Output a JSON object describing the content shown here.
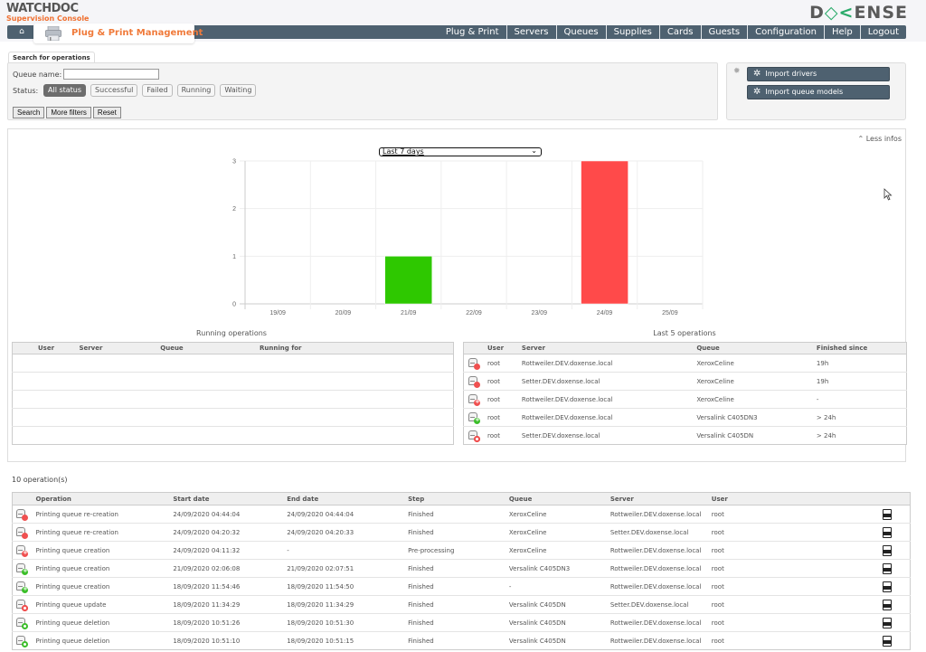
{
  "header": {
    "logo_brand": "WATCHDOC",
    "logo_subtitle": "Supervision Console",
    "vendor_logo_left": "D",
    "vendor_logo_mark": "◇<",
    "vendor_logo_right": "ENSE",
    "section_title": "Plug & Print Management",
    "home_icon": "home-icon",
    "nav": [
      {
        "label": "Plug & Print"
      },
      {
        "label": "Servers"
      },
      {
        "label": "Queues"
      },
      {
        "label": "Supplies"
      },
      {
        "label": "Cards"
      },
      {
        "label": "Guests"
      },
      {
        "label": "Configuration"
      },
      {
        "label": "Help"
      },
      {
        "label": "Logout"
      }
    ]
  },
  "search": {
    "tab_label": "Search for operations",
    "queue_name_label": "Queue name:",
    "queue_name_value": "",
    "status_label": "Status:",
    "statuses": [
      {
        "label": "All status",
        "active": true
      },
      {
        "label": "Successful",
        "active": false
      },
      {
        "label": "Failed",
        "active": false
      },
      {
        "label": "Running",
        "active": false
      },
      {
        "label": "Waiting",
        "active": false
      }
    ],
    "search_button": "Search",
    "more_filters_button": "More filters",
    "reset_button": "Reset"
  },
  "imports": {
    "import_drivers": "Import drivers",
    "import_queue_models": "Import queue models"
  },
  "stats": {
    "less_infos": "Less infos",
    "period_selected": "Last 7 days",
    "running_title": "Running operations",
    "running_columns": [
      "User",
      "Server",
      "Queue",
      "Running for"
    ],
    "running_rows": [],
    "last5_title": "Last 5 operations",
    "last5_columns": [
      "",
      "User",
      "Server",
      "Queue",
      "Finished since"
    ],
    "last5_rows": [
      {
        "status": "failed",
        "user": "root",
        "server": "Rottweiler.DEV.doxense.local",
        "queue": "XeroxCeline",
        "finished_since": "19h"
      },
      {
        "status": "failed",
        "user": "root",
        "server": "Setter.DEV.doxense.local",
        "queue": "XeroxCeline",
        "finished_since": "19h"
      },
      {
        "status": "running-failed",
        "user": "root",
        "server": "Rottweiler.DEV.doxense.local",
        "queue": "XeroxCeline",
        "finished_since": "-"
      },
      {
        "status": "success",
        "user": "root",
        "server": "Rottweiler.DEV.doxense.local",
        "queue": "Versalink C405DN3",
        "finished_since": "> 24h"
      },
      {
        "status": "update-failed",
        "user": "root",
        "server": "Setter.DEV.doxense.local",
        "queue": "Versalink C405DN",
        "finished_since": "> 24h"
      }
    ]
  },
  "chart_data": {
    "type": "bar",
    "title": "",
    "xlabel": "",
    "ylabel": "",
    "categories": [
      "19/09",
      "20/09",
      "21/09",
      "22/09",
      "23/09",
      "24/09",
      "25/09"
    ],
    "series": [
      {
        "name": "Successful",
        "color": "#2ec800",
        "values": [
          0,
          0,
          1,
          0,
          0,
          0,
          0
        ]
      },
      {
        "name": "Failed",
        "color": "#ff4a4a",
        "values": [
          0,
          0,
          0,
          0,
          0,
          3,
          0
        ]
      }
    ],
    "yticks": [
      0,
      1,
      2,
      3
    ],
    "ylim": [
      0,
      3
    ],
    "grid": true,
    "legend": "none"
  },
  "operations": {
    "count_label": "10 operation(s)",
    "columns": [
      "",
      "Operation",
      "Start date",
      "End date",
      "Step",
      "Queue",
      "Server",
      "User",
      ""
    ],
    "rows": [
      {
        "status": "failed",
        "operation": "Printing queue re-creation",
        "start": "24/09/2020 04:44:04",
        "end": "24/09/2020 04:44:04",
        "step": "Finished",
        "queue": "XeroxCeline",
        "server": "Rottweiler.DEV.doxense.local",
        "user": "root"
      },
      {
        "status": "failed",
        "operation": "Printing queue re-creation",
        "start": "24/09/2020 04:20:32",
        "end": "24/09/2020 04:20:33",
        "step": "Finished",
        "queue": "XeroxCeline",
        "server": "Setter.DEV.doxense.local",
        "user": "root"
      },
      {
        "status": "running-failed",
        "operation": "Printing queue creation",
        "start": "24/09/2020 04:11:32",
        "end": "-",
        "step": "Pre-processing",
        "queue": "XeroxCeline",
        "server": "Rottweiler.DEV.doxense.local",
        "user": "root"
      },
      {
        "status": "success",
        "operation": "Printing queue creation",
        "start": "21/09/2020 02:06:08",
        "end": "21/09/2020 02:07:51",
        "step": "Finished",
        "queue": "Versalink C405DN3",
        "server": "Rottweiler.DEV.doxense.local",
        "user": "root"
      },
      {
        "status": "success",
        "operation": "Printing queue creation",
        "start": "18/09/2020 11:54:46",
        "end": "18/09/2020 11:54:50",
        "step": "Finished",
        "queue": "-",
        "server": "Rottweiler.DEV.doxense.local",
        "user": "root"
      },
      {
        "status": "update-failed",
        "operation": "Printing queue update",
        "start": "18/09/2020 11:34:29",
        "end": "18/09/2020 11:34:29",
        "step": "Finished",
        "queue": "Versalink C405DN",
        "server": "Setter.DEV.doxense.local",
        "user": "root"
      },
      {
        "status": "delete-success",
        "operation": "Printing queue deletion",
        "start": "18/09/2020 10:51:26",
        "end": "18/09/2020 10:51:30",
        "step": "Finished",
        "queue": "Versalink C405DN",
        "server": "Rottweiler.DEV.doxense.local",
        "user": "root"
      },
      {
        "status": "delete-success",
        "operation": "Printing queue deletion",
        "start": "18/09/2020 10:51:10",
        "end": "18/09/2020 10:51:15",
        "step": "Finished",
        "queue": "Versalink C405DN",
        "server": "Rottweiler.DEV.doxense.local",
        "user": "root"
      }
    ],
    "log_icon": "log-file-icon"
  }
}
